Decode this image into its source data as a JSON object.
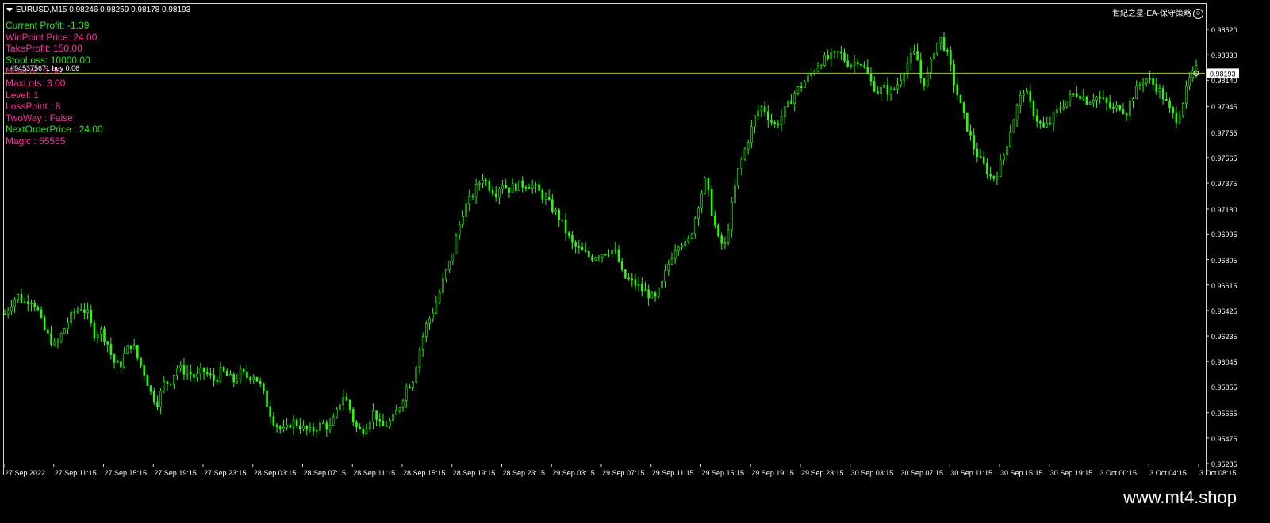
{
  "header": {
    "symbol_line": "EURUSD,M15  0.98246 0.98259 0.98178 0.98193",
    "ea_name": "世紀之星-EA-保守策略",
    "smiley_glyph": "☺"
  },
  "info_panel": [
    {
      "label": "Current Profit:",
      "value": "-1.39",
      "color": "#29e61a"
    },
    {
      "label": "WinPoint Price:",
      "value": "24.00",
      "color": "#ff2fa0"
    },
    {
      "label": "TakeProfit:",
      "value": "150.00",
      "color": "#ff2fa0"
    },
    {
      "label": "StopLoss:",
      "value": "10000.00",
      "color": "#29e61a"
    },
    {
      "label": "NowLot:",
      "value": "0.06",
      "color": "#ff2fa0"
    },
    {
      "label": "MaxLots:",
      "value": "3.00",
      "color": "#ff2fa0"
    },
    {
      "label": "Level:",
      "value": "1",
      "color": "#ff2fa0"
    },
    {
      "label": "LossPoint :",
      "value": "8",
      "color": "#ff2fa0"
    },
    {
      "label": "TwoWay :",
      "value": "False",
      "color": "#ff2fa0"
    },
    {
      "label": "NextOrderPrice :",
      "value": "24.00",
      "color": "#29e61a"
    },
    {
      "label": "Magic :",
      "value": "55555",
      "color": "#ff2fa0"
    }
  ],
  "order_line": {
    "label": "#945375671 buy 0.06",
    "price": 0.98193
  },
  "current_price_label": "0.98193",
  "colors": {
    "candle": "#23ff00",
    "order_line": "#9acd32",
    "background": "#000000",
    "grid_frame": "#d8d8d8"
  },
  "chart_data": {
    "type": "candlestick",
    "symbol": "EURUSD",
    "timeframe": "M15",
    "ylim": [
      0.95285,
      0.9852
    ],
    "y_ticks": [
      "0.98520",
      "0.98330",
      "0.98140",
      "0.97945",
      "0.97755",
      "0.97565",
      "0.97375",
      "0.97180",
      "0.96995",
      "0.96805",
      "0.96615",
      "0.96425",
      "0.96235",
      "0.96045",
      "0.95855",
      "0.95665",
      "0.95475",
      "0.95285"
    ],
    "x_ticks": [
      "27 Sep 2022",
      "27 Sep 11:15",
      "27 Sep 15:15",
      "27 Sep 19:15",
      "27 Sep 23:15",
      "28 Sep 03:15",
      "28 Sep 07:15",
      "28 Sep 11:15",
      "28 Sep 15:15",
      "28 Sep 19:15",
      "28 Sep 23:15",
      "29 Sep 03:15",
      "29 Sep 07:15",
      "29 Sep 11:15",
      "29 Sep 15:15",
      "29 Sep 19:15",
      "29 Sep 23:15",
      "30 Sep 03:15",
      "30 Sep 07:15",
      "30 Sep 11:15",
      "30 Sep 15:15",
      "30 Sep 19:15",
      "3 Oct 00:15",
      "3 Oct 04:15",
      "3 Oct 08:15"
    ],
    "close_path": [
      0.964,
      0.9648,
      0.9654,
      0.9648,
      0.9652,
      0.9645,
      0.963,
      0.9622,
      0.9615,
      0.9626,
      0.9635,
      0.9642,
      0.9645,
      0.964,
      0.9625,
      0.9628,
      0.962,
      0.9605,
      0.96,
      0.9612,
      0.9618,
      0.9605,
      0.9595,
      0.958,
      0.9574,
      0.9588,
      0.959,
      0.96,
      0.9598,
      0.9596,
      0.9592,
      0.9598,
      0.9594,
      0.959,
      0.9598,
      0.9593,
      0.959,
      0.9596,
      0.9593,
      0.9595,
      0.9588,
      0.9575,
      0.9562,
      0.9555,
      0.9552,
      0.956,
      0.9558,
      0.9554,
      0.9552,
      0.9556,
      0.9558,
      0.9555,
      0.9565,
      0.958,
      0.9572,
      0.9556,
      0.9552,
      0.956,
      0.9568,
      0.9555,
      0.9558,
      0.9562,
      0.9572,
      0.9585,
      0.959,
      0.9612,
      0.963,
      0.964,
      0.9652,
      0.9668,
      0.968,
      0.97,
      0.9718,
      0.9725,
      0.9734,
      0.9742,
      0.9735,
      0.973,
      0.9738,
      0.9733,
      0.9735,
      0.9736,
      0.9737,
      0.9735,
      0.973,
      0.9725,
      0.9718,
      0.9712,
      0.9702,
      0.9692,
      0.9688,
      0.9685,
      0.9682,
      0.9684,
      0.9686,
      0.9688,
      0.9685,
      0.9668,
      0.9665,
      0.9662,
      0.9658,
      0.9655,
      0.965,
      0.966,
      0.9675,
      0.9688,
      0.9695,
      0.969,
      0.9705,
      0.9725,
      0.974,
      0.9715,
      0.9695,
      0.969,
      0.9718,
      0.9745,
      0.976,
      0.9775,
      0.979,
      0.9795,
      0.9785,
      0.978,
      0.9788,
      0.9796,
      0.9805,
      0.981,
      0.9815,
      0.9822,
      0.9828,
      0.983,
      0.9832,
      0.9835,
      0.9828,
      0.9826,
      0.983,
      0.9822,
      0.9812,
      0.9806,
      0.9808,
      0.9805,
      0.981,
      0.982,
      0.983,
      0.9835,
      0.981,
      0.982,
      0.984,
      0.9845,
      0.9832,
      0.9812,
      0.9795,
      0.978,
      0.9765,
      0.9755,
      0.9748,
      0.974,
      0.9748,
      0.9762,
      0.978,
      0.9796,
      0.9808,
      0.9795,
      0.9785,
      0.9778,
      0.9782,
      0.979,
      0.9796,
      0.98,
      0.9805,
      0.9803,
      0.9798,
      0.9802,
      0.98,
      0.9796,
      0.9792,
      0.9795,
      0.979,
      0.9802,
      0.981,
      0.9816,
      0.9812,
      0.9808,
      0.98,
      0.979,
      0.9785,
      0.98,
      0.9815,
      0.9822
    ]
  },
  "brand": "www.mt4.shop"
}
